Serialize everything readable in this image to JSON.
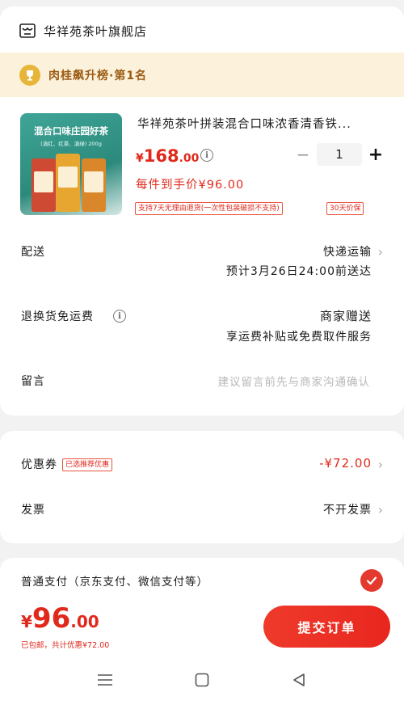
{
  "store": {
    "name": "华祥苑茶叶旗舰店",
    "icon": "store-icon"
  },
  "rank": {
    "text": "肉桂飙升榜·第1名",
    "icon": "trophy-icon"
  },
  "product": {
    "thumb_title": "混合口味庄园好茶",
    "thumb_sub": "(滇红、红茶、滇绿) 200g",
    "title": "华祥苑茶叶拼装混合口味浓香清香铁...",
    "price_symbol": "¥",
    "price_int": "168",
    "price_dec": ".00",
    "quantity": "1",
    "minus": "−",
    "plus": "+",
    "each_price": "每件到手价¥96.00",
    "tags": [
      "支持7天无理由退货(一次性包装破损不支持)",
      "30天价保"
    ]
  },
  "delivery": {
    "label": "配送",
    "method": "快递运输",
    "eta": "预计3月26日24:00前送达"
  },
  "return_fee": {
    "label": "退换货免运费",
    "value": "商家赠送",
    "desc": "享运费补贴或免费取件服务"
  },
  "note": {
    "label": "留言",
    "placeholder": "建议留言前先与商家沟通确认"
  },
  "coupon": {
    "label": "优惠券",
    "tag": "已选推荐优惠",
    "value": "-¥72.00"
  },
  "invoice": {
    "label": "发票",
    "value": "不开发票"
  },
  "payment": {
    "label": "普通支付（京东支付、微信支付等）",
    "selected": true
  },
  "bottom": {
    "total_symbol": "¥",
    "total_int": "96",
    "total_dec": ".00",
    "ship_note": "已包邮，共计优惠¥72.00",
    "submit": "提交订单"
  },
  "colors": {
    "accent": "#e0291b",
    "rank_bg": "#fcf2dc",
    "rank_text": "#9b5b13"
  }
}
